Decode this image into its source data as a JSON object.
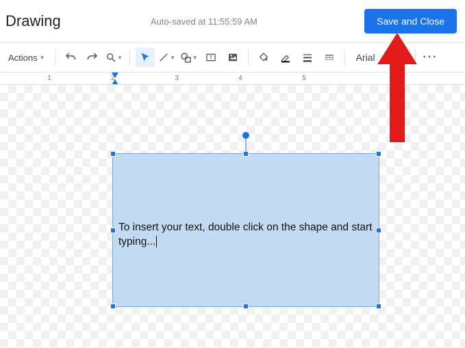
{
  "header": {
    "title": "Drawing",
    "autosave": "Auto-saved at 11:55:59 AM",
    "save_close": "Save and Close"
  },
  "toolbar": {
    "actions": "Actions",
    "font_family": "Arial"
  },
  "ruler": {
    "labels": [
      "1",
      "2",
      "3",
      "4",
      "5"
    ]
  },
  "canvas": {
    "shape_text": "To insert your text, double click on the shape and start typing..."
  }
}
